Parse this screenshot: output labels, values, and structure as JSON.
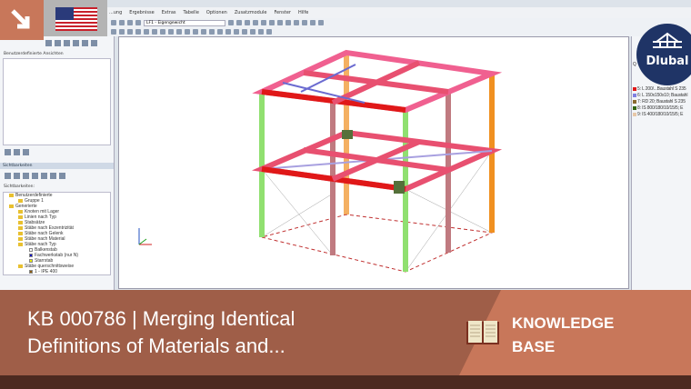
{
  "menu": [
    "...ung",
    "Ergebnisse",
    "Extras",
    "Tabelle",
    "Optionen",
    "Zusatzmodule",
    "Fenster",
    "Hilfe"
  ],
  "toolbar": {
    "loadcase": "LF1 - Eigengewicht"
  },
  "left_panel": {
    "views_label": "Benutzerdefinierte Ansichten",
    "visibility_section": "Sichtbarkeiten",
    "visibility_checkbox": "Sichtbarkeiten:",
    "tree": [
      "Benutzerdefinierte",
      "Gruppe 1",
      "Generierte",
      "Knoten mit Lager",
      "Linien nach Typ",
      "Stabsätze",
      "Stäbe nach Exzentrizität",
      "Stäbe nach Gelenk",
      "Stäbe nach Material",
      "Stäbe nach Typ",
      "Balkenstab",
      "Fachwerkstab (nur N)",
      "Starrstab",
      "Stäbe querschnittsweise",
      "1 - IPE 400"
    ]
  },
  "legend": {
    "title": "Q",
    "items": [
      {
        "label": "5: L 200/...Baustahl S 235",
        "color": "#e01818"
      },
      {
        "label": "6: L 150x150x10; Baustahl",
        "color": "#8080e0"
      },
      {
        "label": "7: RD 20; Baustahl S 235",
        "color": "#8a6a30"
      },
      {
        "label": "8: IS 800/180/10/15/5; E",
        "color": "#336611"
      },
      {
        "label": "9: IS 400/180/10/15/5; E",
        "color": "#e8c8a8"
      }
    ]
  },
  "logo": "Dlubal",
  "banner": {
    "title_line1": "KB 000786 | Merging Identical",
    "title_line2": "Definitions of Materials and...",
    "category_line1": "KNOWLEDGE",
    "category_line2": "BASE"
  },
  "colors": {
    "banner_dark": "#9f5e48",
    "banner_light": "#c8775a",
    "footer": "#4d2a20",
    "brand": "#1f3466"
  }
}
